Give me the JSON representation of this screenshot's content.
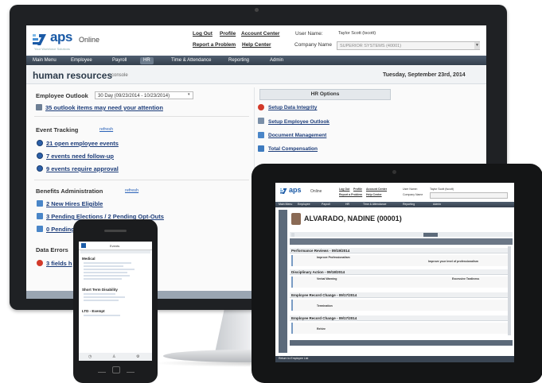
{
  "brand": {
    "logo": "aps",
    "logo_tagline": "Your Workforce Solutions",
    "product": "Online"
  },
  "header": {
    "links_row1": [
      "Log Out",
      "Profile",
      "Account Center"
    ],
    "links_row2": [
      "Report a Problem",
      "Help Center"
    ],
    "user_label": "User Name:",
    "user_value": "Taylor Scott (tscott)",
    "company_label": "Company Name",
    "company_value": "SUPERIOR SYSTEMS (40001)"
  },
  "nav": [
    "Main Menu",
    "Employee",
    "Payroll",
    "HR",
    "Time & Attendance",
    "Reporting",
    "Admin"
  ],
  "nav_active": "HR",
  "page": {
    "title": "human resources",
    "subtitle": "console",
    "date": "Tuesday, September 23rd, 2014"
  },
  "employee_outlook": {
    "label": "Employee Outlook",
    "select_value": "30 Day (09/23/2014 - 10/23/2014)",
    "item": "35 outlook items may need your attention"
  },
  "event_tracking": {
    "label": "Event Tracking",
    "refresh": "refresh",
    "items": [
      "21 open employee events",
      "7 events need follow-up",
      "9 events require approval"
    ]
  },
  "benefits": {
    "label": "Benefits Administration",
    "refresh": "refresh",
    "items": [
      "2 New Hires Eligible",
      "3 Pending Elections / 2 Pending Opt-Outs",
      "0 Pending"
    ]
  },
  "data_errors": {
    "label": "Data Errors",
    "item": "3 fields h"
  },
  "hr_options": {
    "title": "HR Options",
    "items": [
      "Setup Data Integrity",
      "Setup Employee Outlook",
      "Document Management",
      "Total Compensation"
    ]
  },
  "tablet": {
    "brand": "aps",
    "product": "Online",
    "employee_name": "ALVARADO, NADINE (00001)",
    "sections": [
      "Performance Reviews - 09/19/2014",
      "Disciplinary Action - 09/18/2014",
      "Employee Record Change - 09/17/2014",
      "Employee Record Change - 09/17/2014"
    ],
    "field_texts": [
      "Improve Professionalism",
      "Improve your level of professionalism",
      "Verbal Warning",
      "Excessive Tardiness",
      "Termination",
      "Rehire"
    ],
    "footer": "Return to Employee List"
  },
  "phone": {
    "title": "Events",
    "sections": [
      "Medical",
      "Short Term Disability",
      "LTD - Exempt"
    ]
  },
  "colors": {
    "brand_blue": "#1a5aa6",
    "nav_dark": "#35404d",
    "link_blue": "#1d3d7a",
    "error_red": "#d23a2a"
  }
}
